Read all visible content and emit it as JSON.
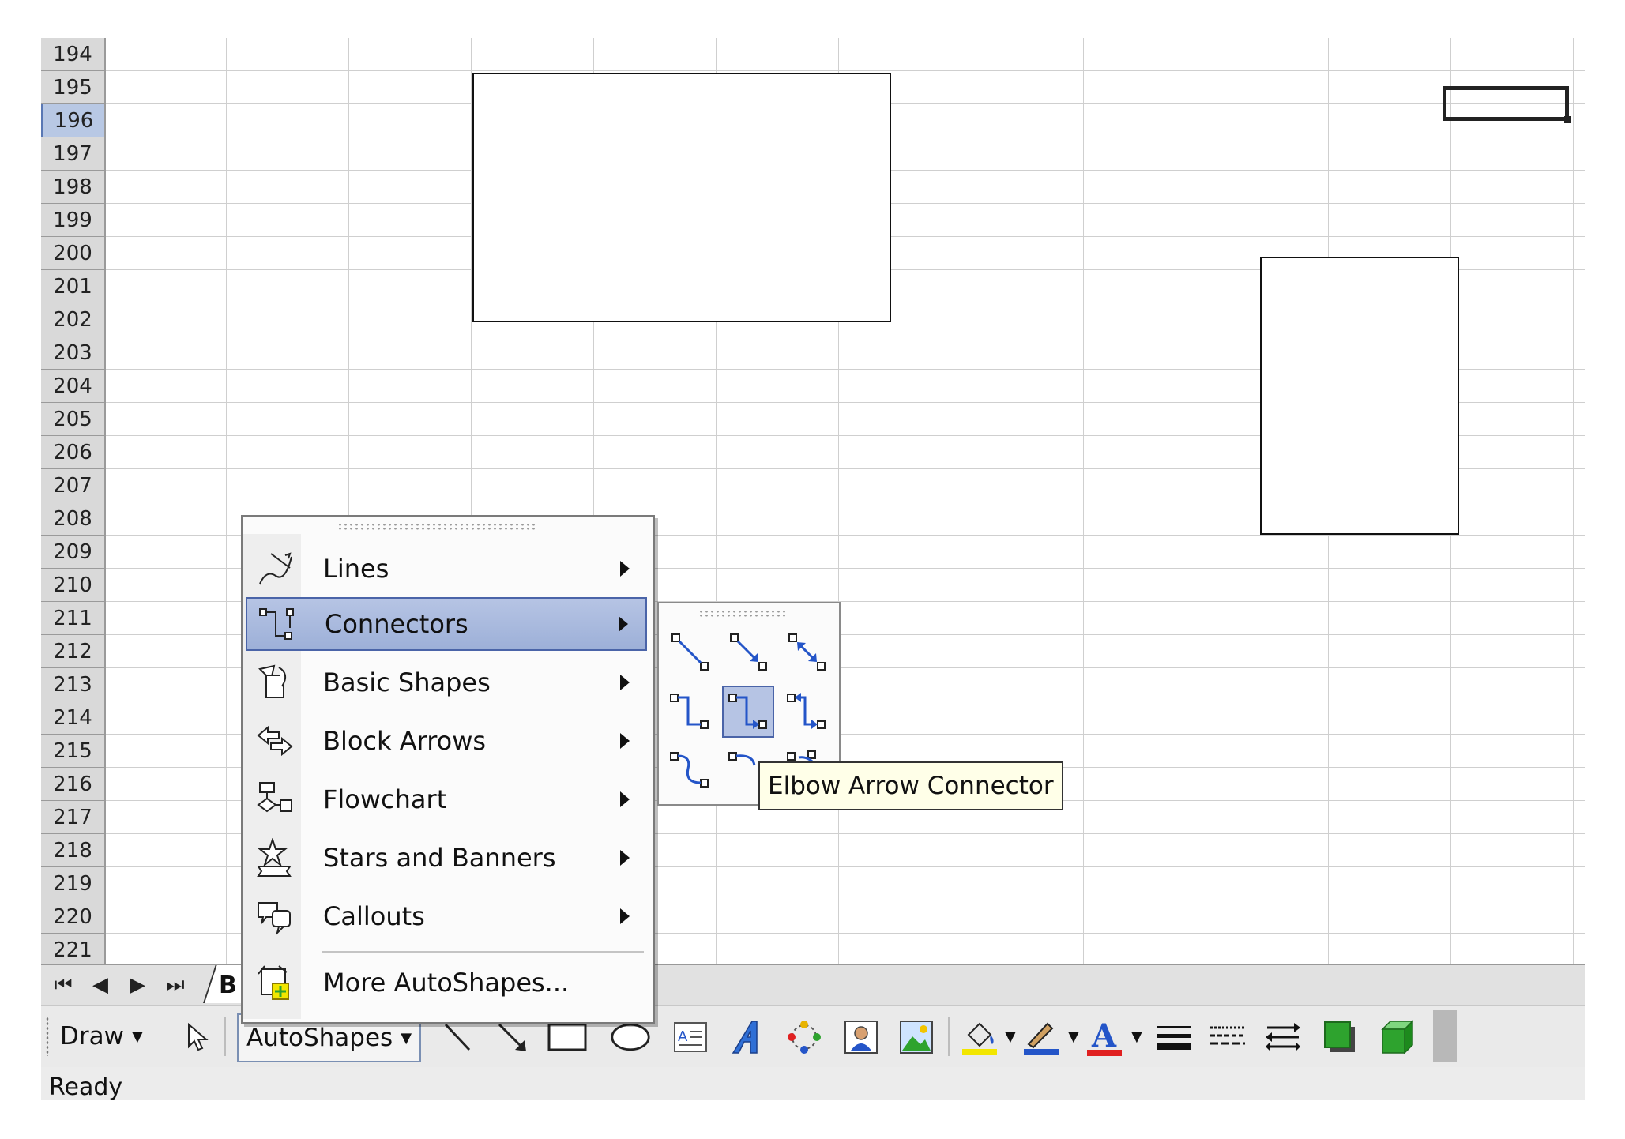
{
  "rows": [
    "194",
    "195",
    "196",
    "197",
    "198",
    "199",
    "200",
    "201",
    "202",
    "203",
    "204",
    "205",
    "206",
    "207",
    "208",
    "209",
    "210",
    "211",
    "212",
    "213",
    "214",
    "215",
    "216",
    "217",
    "218",
    "219",
    "220",
    "221"
  ],
  "active_row": "196",
  "sheet_tab": {
    "label": "B"
  },
  "autoshapes_menu": {
    "items": [
      {
        "label": "Lines",
        "icon": "lines-icon",
        "submenu": true
      },
      {
        "label": "Connectors",
        "icon": "connectors-icon",
        "submenu": true,
        "highlighted": true
      },
      {
        "label": "Basic Shapes",
        "icon": "basic-shapes-icon",
        "submenu": true
      },
      {
        "label": "Block Arrows",
        "icon": "block-arrows-icon",
        "submenu": true
      },
      {
        "label": "Flowchart",
        "icon": "flowchart-icon",
        "submenu": true
      },
      {
        "label": "Stars and Banners",
        "icon": "stars-banners-icon",
        "submenu": true
      },
      {
        "label": "Callouts",
        "icon": "callouts-icon",
        "submenu": true
      },
      {
        "label": "More AutoShapes...",
        "icon": "more-autoshapes-icon",
        "submenu": false
      }
    ]
  },
  "connectors_menu": {
    "buttons": [
      "straight-connector",
      "straight-arrow-connector",
      "straight-double-arrow-connector",
      "elbow-connector",
      "elbow-arrow-connector",
      "elbow-double-arrow-connector",
      "curved-connector",
      "curved-arrow-connector",
      "curved-double-arrow-connector"
    ],
    "selected": "elbow-arrow-connector"
  },
  "tooltip": {
    "text": "Elbow Arrow Connector"
  },
  "toolbar": {
    "draw_label": "Draw",
    "autoshapes_label": "AutoShapes",
    "icons": [
      "select-objects-icon",
      "line-icon",
      "arrow-icon",
      "rectangle-icon",
      "oval-icon",
      "text-box-icon",
      "wordart-icon",
      "diagram-icon",
      "clip-art-icon",
      "picture-icon",
      "fill-color-icon",
      "line-color-icon",
      "font-color-icon",
      "line-style-icon",
      "dash-style-icon",
      "arrow-style-icon",
      "shadow-icon",
      "3d-icon"
    ]
  },
  "status": {
    "text": "Ready"
  },
  "colors": {
    "highlight": "#b6c4e4",
    "fill_yellow": "#f2e600",
    "line_blue": "#2455c8",
    "font_red": "#e02020",
    "shadow_green": "#2ea32e"
  }
}
